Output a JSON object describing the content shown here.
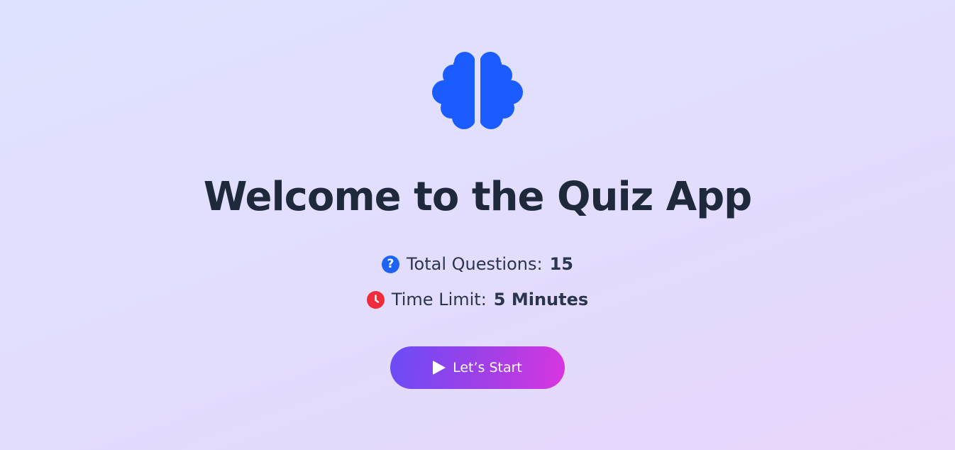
{
  "logo": {
    "icon": "brain-icon",
    "color": "#1a5cff"
  },
  "title": "Welcome to the Quiz App",
  "info": {
    "questions": {
      "icon": "question-circle-icon",
      "label": "Total Questions:",
      "value": "15",
      "color": "#1e63f5"
    },
    "time": {
      "icon": "clock-icon",
      "label": "Time Limit:",
      "value": "5 Minutes",
      "color": "#ef2b3c"
    }
  },
  "start_button": {
    "icon": "play-icon",
    "label": "Let’s Start"
  }
}
